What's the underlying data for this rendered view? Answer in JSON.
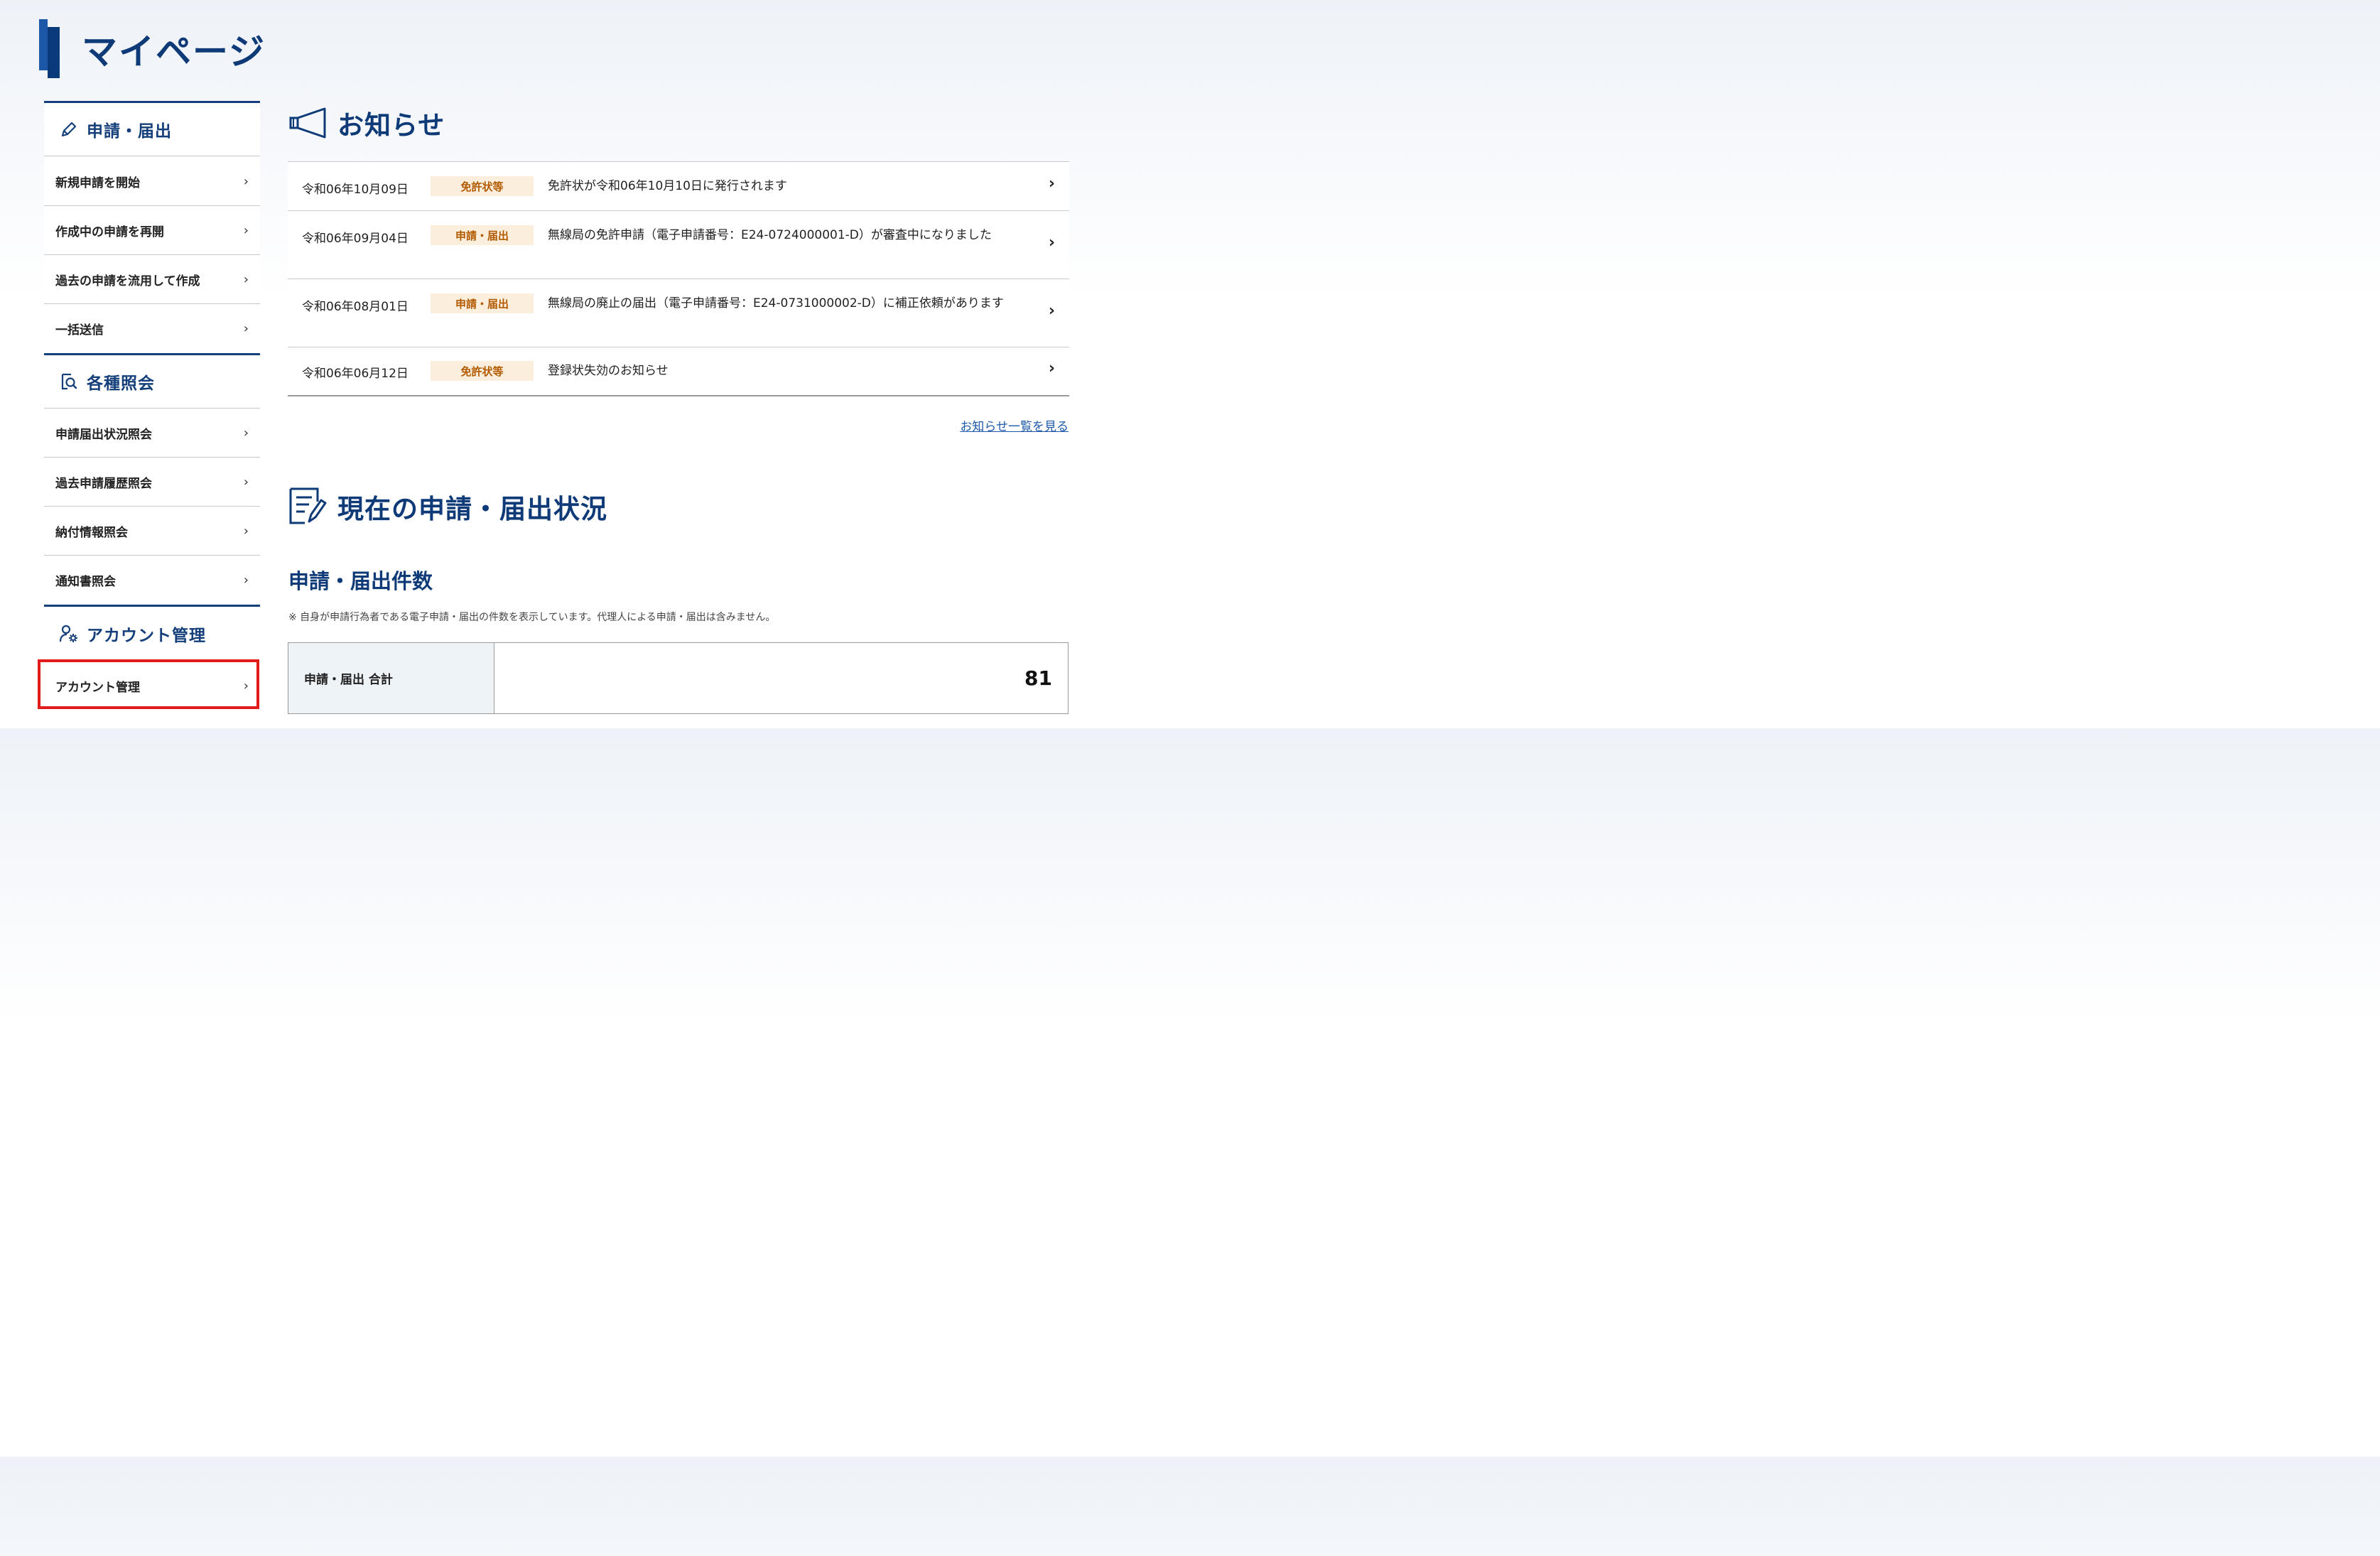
{
  "page": {
    "title": "マイページ"
  },
  "sidebar": {
    "sections": [
      {
        "icon": "pencil-icon",
        "label": "申請・届出",
        "items": [
          "新規申請を開始",
          "作成中の申請を再開",
          "過去の申請を流用して作成",
          "一括送信"
        ]
      },
      {
        "icon": "document-search-icon",
        "label": "各種照会",
        "items": [
          "申請届出状況照会",
          "過去申請履歴照会",
          "納付情報照会",
          "通知書照会"
        ]
      },
      {
        "icon": "user-gear-icon",
        "label": "アカウント管理",
        "items": [
          "アカウント管理"
        ]
      }
    ],
    "chevron": "›"
  },
  "notices": {
    "title": "お知らせ",
    "icon": "megaphone-icon",
    "items": [
      {
        "date": "令和06年10月09日",
        "category": "免許状等",
        "message": "免許状が令和06年10月10日に発行されます"
      },
      {
        "date": "令和06年09月04日",
        "category": "申請・届出",
        "message": "無線局の免許申請（電子申請番号：E24-0724000001-D）が審査中になりました"
      },
      {
        "date": "令和06年08月01日",
        "category": "申請・届出",
        "message": "無線局の廃止の届出（電子申請番号：E24-0731000002-D）に補正依頼があります"
      },
      {
        "date": "令和06年06月12日",
        "category": "免許状等",
        "message": "登録状失効のお知らせ"
      }
    ],
    "chevron": "›",
    "more_link": "お知らせ一覧を見る"
  },
  "status": {
    "title": "現在の申請・届出状況",
    "icon": "clipboard-pen-icon",
    "subtitle": "申請・届出件数",
    "note": "※ 自身が申請行為者である電子申請・届出の件数を表示しています。代理人による申請・届出は含みません。",
    "total_label": "申請・届出 合計",
    "total_value": "81"
  },
  "colors": {
    "primary": "#0e3a78",
    "accent": "#1d58a8",
    "badge_bg": "#fbeedc",
    "badge_text": "#b25a00",
    "highlight": "#e21b1b"
  }
}
